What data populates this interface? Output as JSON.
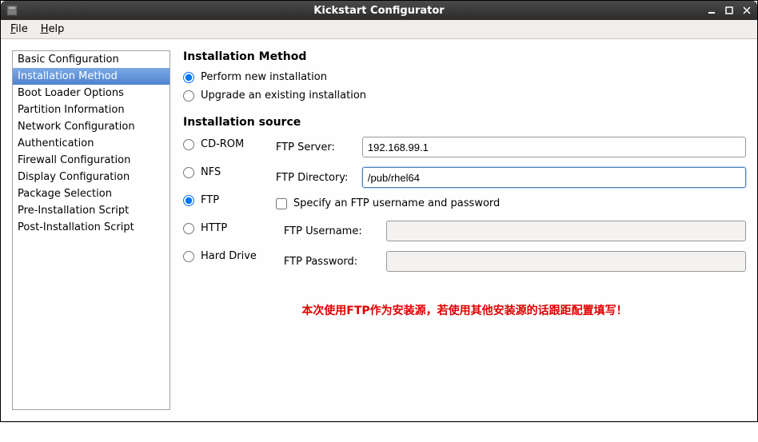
{
  "window": {
    "title": "Kickstart Configurator"
  },
  "menu": {
    "file": "File",
    "help": "Help"
  },
  "sidebar": {
    "items": [
      "Basic Configuration",
      "Installation Method",
      "Boot Loader Options",
      "Partition Information",
      "Network Configuration",
      "Authentication",
      "Firewall Configuration",
      "Display Configuration",
      "Package Selection",
      "Pre-Installation Script",
      "Post-Installation Script"
    ],
    "selected_index": 1
  },
  "main": {
    "method_heading": "Installation Method",
    "method_options": {
      "new": "Perform new installation",
      "upgrade": "Upgrade an existing installation",
      "selected": "new"
    },
    "source_heading": "Installation source",
    "source_options": {
      "cdrom": "CD-ROM",
      "nfs": "NFS",
      "ftp": "FTP",
      "http": "HTTP",
      "hd": "Hard Drive",
      "selected": "ftp"
    },
    "ftp": {
      "server_label": "FTP Server:",
      "server_value": "192.168.99.1",
      "dir_label": "FTP Directory:",
      "dir_value": "/pub/rhel64",
      "auth_checkbox_label": "Specify an FTP username and password",
      "auth_checked": false,
      "user_label": "FTP Username:",
      "user_value": "",
      "pass_label": "FTP Password:",
      "pass_value": ""
    },
    "note": "本次使用FTP作为安装源，若使用其他安装源的话跟距配置填写！"
  }
}
